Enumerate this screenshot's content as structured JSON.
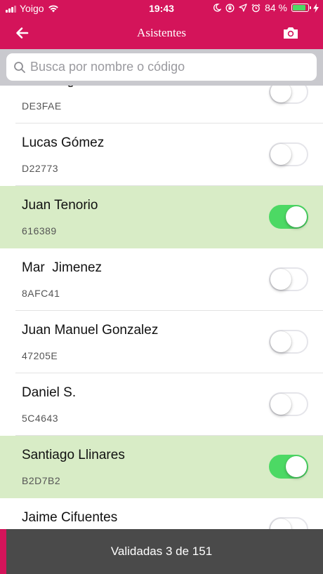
{
  "status_bar": {
    "carrier": "Yoigo",
    "time": "19:43",
    "battery_percent_label": "84 %",
    "battery_level": 0.84,
    "icons": [
      "signal-icon",
      "wifi-icon",
      "moon-icon",
      "orientation-lock-icon",
      "location-icon",
      "alarm-icon",
      "battery-icon",
      "charging-icon"
    ]
  },
  "nav": {
    "title": "Asistentes",
    "back_icon": "arrow-left-icon",
    "camera_icon": "camera-icon"
  },
  "search": {
    "placeholder": "Busca por nombre o código",
    "value": ""
  },
  "attendees": [
    {
      "name": "Iván Segovia",
      "code": "DE3FAE",
      "validated": false
    },
    {
      "name": "Lucas Gómez",
      "code": "D22773",
      "validated": false
    },
    {
      "name": "Juan Tenorio",
      "code": "616389",
      "validated": true
    },
    {
      "name": "Mar  Jimenez",
      "code": "8AFC41",
      "validated": false
    },
    {
      "name": "Juan Manuel Gonzalez",
      "code": "47205E",
      "validated": false
    },
    {
      "name": "Daniel S.",
      "code": "5C4643",
      "validated": false
    },
    {
      "name": "Santiago Llinares",
      "code": "B2D7B2",
      "validated": true
    },
    {
      "name": "Jaime Cifuentes",
      "code": "",
      "validated": false
    }
  ],
  "footer": {
    "text": "Validadas 3 de 151"
  },
  "colors": {
    "brand": "#d4145a",
    "validated_row": "#d8ecc6",
    "toggle_on": "#4cd964",
    "footer_bg": "#4a4a4a"
  }
}
